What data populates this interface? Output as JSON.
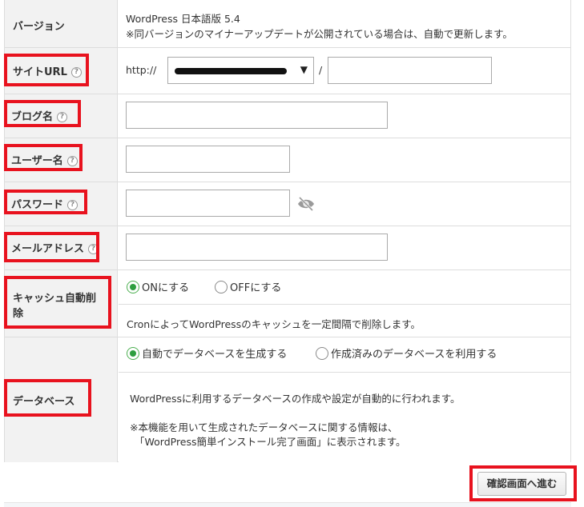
{
  "version": {
    "label": "バージョン",
    "value": "WordPress 日本語版 5.4",
    "note": "※同バージョンのマイナーアップデートが公開されている場合は、自動で更新します。"
  },
  "site_url": {
    "label": "サイトURL",
    "help": "?",
    "protocol": "http://",
    "arrow": "▼",
    "separator": "/",
    "path_value": ""
  },
  "blog_name": {
    "label": "ブログ名",
    "help": "?",
    "value": ""
  },
  "user_name": {
    "label": "ユーザー名",
    "help": "?",
    "value": ""
  },
  "password": {
    "label": "パスワード",
    "help": "?",
    "value": "",
    "toggle_icon": "eye-slash-icon"
  },
  "email": {
    "label": "メールアドレス",
    "help": "?",
    "value": ""
  },
  "cache": {
    "label_line1": "キャッシュ自動削",
    "label_line2": "除",
    "option_on": "ONにする",
    "option_off": "OFFにする",
    "selected": "on",
    "description": "CronによってWordPressのキャッシュを一定間隔で削除します。"
  },
  "database": {
    "label": "データベース",
    "option_auto": "自動でデータベースを生成する",
    "option_existing": "作成済みのデータベースを利用する",
    "selected": "auto",
    "description": "WordPressに利用するデータベースの作成や設定が自動的に行われます。",
    "note_line1": "※本機能を用いて生成されたデータベースに関する情報は、",
    "note_line2": "「WordPress簡単インストール完了画面」に表示されます。"
  },
  "confirm_button": "確認画面へ進む",
  "colors": {
    "highlight": "#e8121e",
    "radio_selected": "#2e9e3f",
    "label_bg": "#f2f2f2",
    "border": "#dddddd"
  }
}
